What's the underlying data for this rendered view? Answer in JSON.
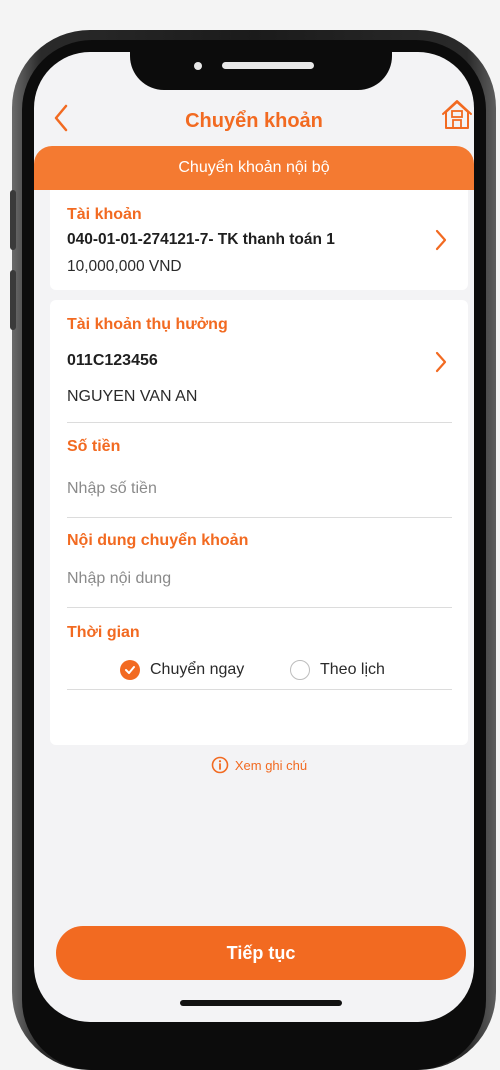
{
  "header": {
    "title": "Chuyển khoản"
  },
  "banner": {
    "label": "Chuyển khoản nội bộ"
  },
  "account": {
    "label": "Tài khoản",
    "number": "040-01-01-274121-7- TK thanh toán 1",
    "balance": "10,000,000 VND"
  },
  "beneficiary": {
    "label": "Tài khoản thụ hưởng",
    "number": "011C123456",
    "name": "NGUYEN VAN AN"
  },
  "amount": {
    "label": "Số tiền",
    "placeholder": "Nhập số tiền"
  },
  "content": {
    "label": "Nội dung chuyển khoản",
    "placeholder": "Nhập nội dung"
  },
  "time": {
    "label": "Thời gian",
    "options": [
      {
        "label": "Chuyển ngay",
        "selected": true
      },
      {
        "label": "Theo lịch",
        "selected": false
      }
    ]
  },
  "note": {
    "label": "Xem ghi chú"
  },
  "continue": {
    "label": "Tiếp tục"
  },
  "colors": {
    "accent": "#f26a21",
    "banner": "#f47a31",
    "background": "#f3f3f5"
  },
  "icons": [
    "chevron-left-icon",
    "home-icon",
    "chevron-right-icon",
    "check-icon",
    "info-icon"
  ]
}
